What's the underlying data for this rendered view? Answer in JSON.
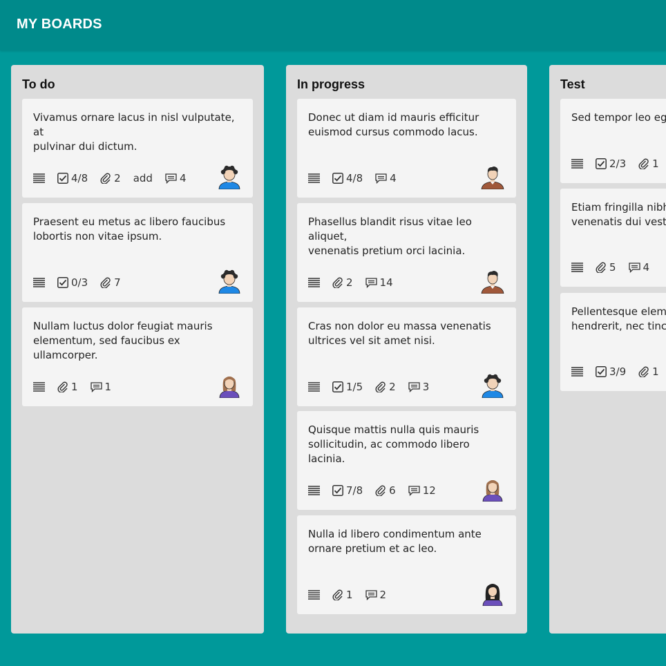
{
  "header": {
    "title": "MY BOARDS"
  },
  "columns": [
    {
      "title": "To do",
      "cards": [
        {
          "text": "Vivamus ornare lacus in nisl vulputate, at\npulvinar dui dictum.",
          "checklist": "4/8",
          "attachments": "2",
          "extra": "add",
          "comments": "4",
          "avatar": "curly-boy-blue"
        },
        {
          "text": "Praesent eu metus ac libero faucibus\nlobortis non vitae ipsum.",
          "checklist": "0/3",
          "attachments": "7",
          "avatar": "curly-boy-blue"
        },
        {
          "text": "Nullam luctus dolor feugiat mauris\nelementum, sed faucibus ex ullamcorper.",
          "attachments": "1",
          "comments": "1",
          "avatar": "girl-purple"
        }
      ]
    },
    {
      "title": "In progress",
      "cards": [
        {
          "text": "Donec ut diam id mauris efficitur\neuismod cursus commodo lacus.",
          "checklist": "4/8",
          "comments": "4",
          "avatar": "man-brown"
        },
        {
          "text": "Phasellus blandit risus vitae leo aliquet,\nvenenatis pretium orci lacinia.",
          "attachments": "2",
          "comments": "14",
          "avatar": "man-brown"
        },
        {
          "text": "Cras non dolor eu massa venenatis\nultrices vel sit amet nisi.",
          "checklist": "1/5",
          "attachments": "2",
          "comments": "3",
          "avatar": "curly-boy-blue"
        },
        {
          "text": "Quisque mattis nulla quis mauris\nsollicitudin, ac commodo libero lacinia.",
          "checklist": "7/8",
          "attachments": "6",
          "comments": "12",
          "avatar": "girl-purple"
        },
        {
          "text": "Nulla id libero condimentum ante\nornare pretium et ac leo.",
          "attachments": "1",
          "comments": "2",
          "avatar": "dark-hair-girl-purple"
        }
      ]
    },
    {
      "title": "Test",
      "cards": [
        {
          "text": "Sed tempor leo eget",
          "checklist": "2/3",
          "attachments": "1"
        },
        {
          "text": "Etiam fringilla nibh\nvenenatis dui vestib",
          "attachments": "5",
          "comments": "4"
        },
        {
          "text": "Pellentesque eleme\nhendrerit, nec tincic",
          "checklist": "3/9",
          "attachments": "1"
        }
      ]
    }
  ],
  "colors": {
    "background": "#00999a",
    "topbar": "#008a8b",
    "column": "#dcdcdc",
    "card": "#f4f4f4"
  }
}
